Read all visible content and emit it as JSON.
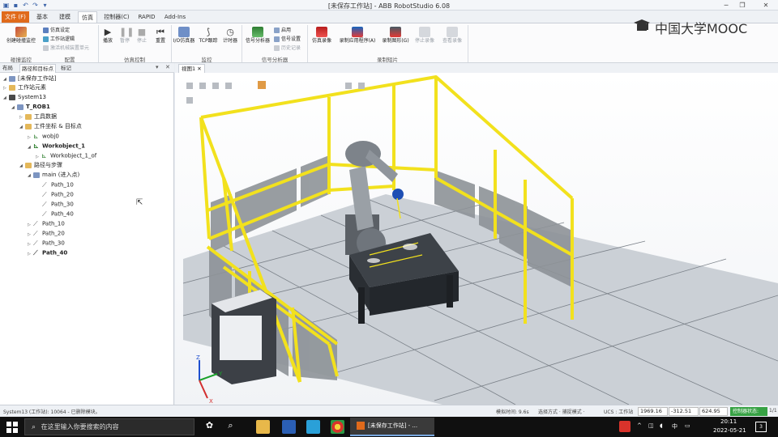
{
  "window": {
    "title": "[未保存工作站] - ABB RobotStudio 6.08"
  },
  "tabs": [
    {
      "label": "文件 (F)"
    },
    {
      "label": "基本"
    },
    {
      "label": "建模"
    },
    {
      "label": "仿真"
    },
    {
      "label": "控制器(C)"
    },
    {
      "label": "RAPID"
    },
    {
      "label": "Add-Ins"
    }
  ],
  "ribbon": {
    "groups": {
      "collision": "碰撞监控",
      "config": "配置",
      "sim_control": "仿真控制",
      "monitor": "监控",
      "signal_analyzer": "信号分析器",
      "recording": "录制短片"
    },
    "buttons": {
      "create_collision": "创建碰撞监控",
      "sim_setup": "仿真设定",
      "station_logic": "工作站逻辑",
      "activate_unit": "激活机械装置单元",
      "play": "播放",
      "pause": "暂停",
      "stop": "停止",
      "reset": "重置",
      "io_sim": "I/O仿真器",
      "tcp_trace": "TCP跟踪",
      "timer": "计时器",
      "signal_analyzer": "信号分析器",
      "enable": "启用",
      "signal_setup": "信号设置",
      "history": "历史记录",
      "sim_record": "仿真录像",
      "record_app": "录制应用程序(A)",
      "record_graphics": "录制图形(G)",
      "stop_record": "停止录像",
      "view_record": "查看录像"
    }
  },
  "logo": {
    "text": "中国大学MOOC"
  },
  "left_panel": {
    "tabs": [
      {
        "label": "布局"
      },
      {
        "label": "路径和目标点"
      },
      {
        "label": "标记"
      }
    ],
    "tree": [
      {
        "label": "[未保存工作站]"
      },
      {
        "label": "工作站元素"
      },
      {
        "label": "System13"
      },
      {
        "label": "T_ROB1"
      },
      {
        "label": "工具数据"
      },
      {
        "label": "工件坐标 & 目标点"
      },
      {
        "label": "wobj0"
      },
      {
        "label": "Workobject_1"
      },
      {
        "label": "Workobject_1_of"
      },
      {
        "label": "路径与步骤"
      },
      {
        "label": "main (进入点)"
      },
      {
        "label": "Path_10"
      },
      {
        "label": "Path_20"
      },
      {
        "label": "Path_30"
      },
      {
        "label": "Path_40"
      },
      {
        "label": "Path_10"
      },
      {
        "label": "Path_20"
      },
      {
        "label": "Path_30"
      },
      {
        "label": "Path_40"
      }
    ]
  },
  "view": {
    "tab_label": "视图1"
  },
  "statusbar": {
    "message": "System13 (工作站): 10064 - 已删除模块。",
    "sim_time": "模拟时间: 9.6s",
    "select_mode": "选择方式 · 捕捉模式 ·",
    "ucs": "UCS : 工作站",
    "x": "1969.16",
    "y": "-312.51",
    "z": "624.95",
    "controller_state": "控制器状态:",
    "controller_count": "1/1"
  },
  "taskbar": {
    "search_placeholder": "在这里输入你要搜索的内容",
    "active_app": "[未保存工作站] - ...",
    "time": "20:11",
    "date": "2022-05-21",
    "notifications": "3",
    "ime": "中"
  }
}
